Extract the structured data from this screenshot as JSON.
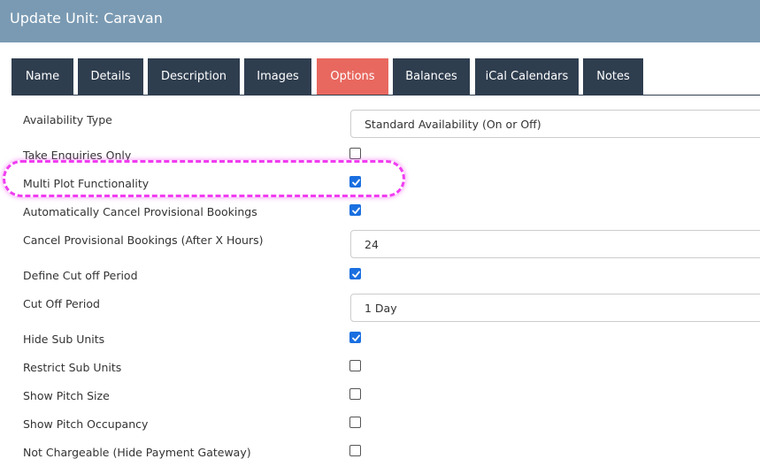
{
  "header": {
    "title": "Update Unit: Caravan"
  },
  "tabs": [
    {
      "label": "Name"
    },
    {
      "label": "Details"
    },
    {
      "label": "Description"
    },
    {
      "label": "Images"
    },
    {
      "label": "Options"
    },
    {
      "label": "Balances"
    },
    {
      "label": "iCal Calendars"
    },
    {
      "label": "Notes"
    }
  ],
  "active_tab": "Options",
  "colors": {
    "header_bg": "#7a9ab3",
    "tab_bg": "#2f3e4f",
    "tab_active_bg": "#e8685f",
    "checkbox_checked": "#1a6fe0",
    "highlight": "#f03df0"
  },
  "options": {
    "availability_type": {
      "label": "Availability Type",
      "value": "Standard Availability (On or Off)"
    },
    "take_enquiries_only": {
      "label": "Take Enquiries Only",
      "checked": false
    },
    "multi_plot_functionality": {
      "label": "Multi Plot Functionality",
      "checked": true
    },
    "auto_cancel_provisional": {
      "label": "Automatically Cancel Provisional Bookings",
      "checked": true
    },
    "cancel_after_hours": {
      "label": "Cancel Provisional Bookings (After X Hours)",
      "value": "24"
    },
    "define_cut_off_period": {
      "label": "Define Cut off Period",
      "checked": true
    },
    "cut_off_period": {
      "label": "Cut Off Period",
      "value": "1 Day"
    },
    "hide_sub_units": {
      "label": "Hide Sub Units",
      "checked": true
    },
    "restrict_sub_units": {
      "label": "Restrict Sub Units",
      "checked": false
    },
    "show_pitch_size": {
      "label": "Show Pitch Size",
      "checked": false
    },
    "show_pitch_occupancy": {
      "label": "Show Pitch Occupancy",
      "checked": false
    },
    "not_chargeable": {
      "label": "Not Chargeable (Hide Payment Gateway)",
      "checked": false
    }
  }
}
